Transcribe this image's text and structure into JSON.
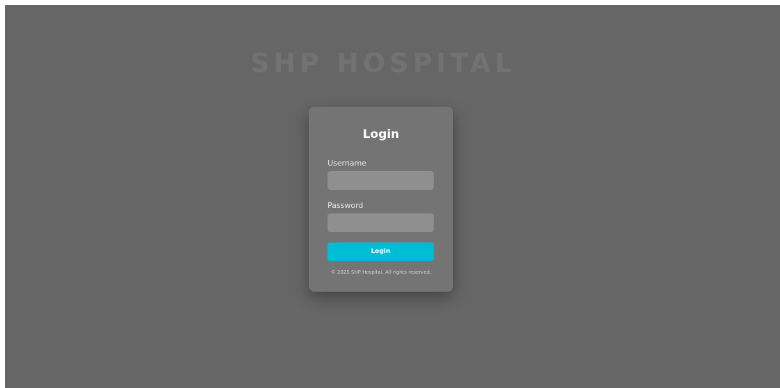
{
  "brand": {
    "title": "SHP HOSPITAL"
  },
  "login_card": {
    "title": "Login",
    "username": {
      "label": "Username",
      "value": "",
      "placeholder": ""
    },
    "password": {
      "label": "Password",
      "value": "",
      "placeholder": ""
    },
    "submit_label": "Login",
    "copyright": "© 2025 SHP Hospital. All rights reserved."
  },
  "colors": {
    "background": "#666666",
    "card": "#747474",
    "input": "#8f8f8f",
    "accent": "#00bcd4"
  }
}
